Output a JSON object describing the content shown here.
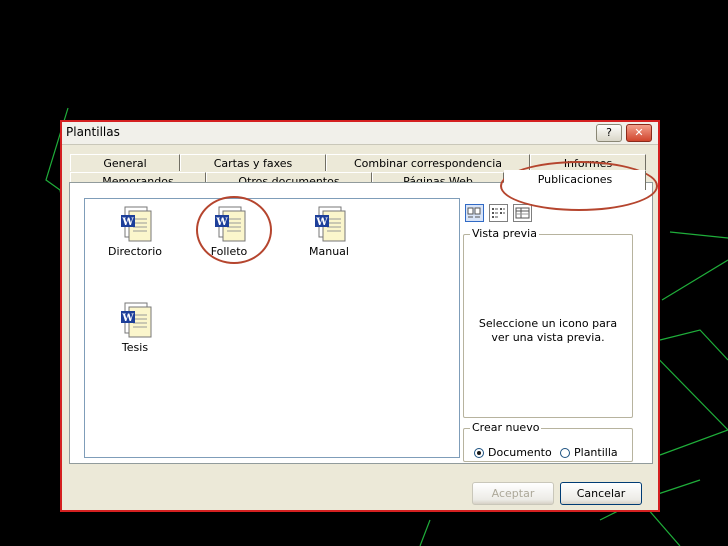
{
  "window": {
    "title": "Plantillas",
    "help_glyph": "?",
    "close_glyph": "✕"
  },
  "tabs_back": [
    "General",
    "Cartas y faxes",
    "Combinar correspondencia",
    "Informes"
  ],
  "tabs_front": [
    "Memorandos",
    "Otros documentos",
    "Páginas Web",
    "Publicaciones"
  ],
  "active_tab": "Publicaciones",
  "templates": [
    {
      "label": "Directorio",
      "icon": "word-document-icon"
    },
    {
      "label": "Folleto",
      "icon": "word-document-icon"
    },
    {
      "label": "Manual",
      "icon": "word-document-icon"
    },
    {
      "label": "Tesis",
      "icon": "word-document-icon"
    }
  ],
  "preview": {
    "legend": "Vista previa",
    "line1": "Seleccione un icono para",
    "line2": "ver una vista previa."
  },
  "create_new": {
    "legend": "Crear nuevo",
    "option_document": "Documento",
    "option_template": "Plantilla",
    "selected": "Documento"
  },
  "buttons": {
    "accept": "Aceptar",
    "cancel": "Cancelar"
  },
  "colors": {
    "annotation": "#b5452e",
    "dialog_border": "#d42020",
    "background": "#000000",
    "accent_lines": "#1fae3a"
  }
}
